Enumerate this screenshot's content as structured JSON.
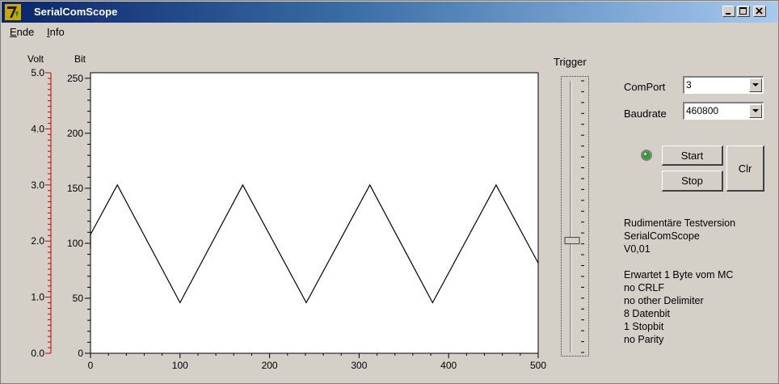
{
  "window": {
    "title": "SerialComScope",
    "app_icon": "delphi-icon"
  },
  "menu": {
    "items": [
      {
        "label": "Ende",
        "accel": "E",
        "rest": "nde"
      },
      {
        "label": "Info",
        "accel": "I",
        "rest": "nfo"
      }
    ]
  },
  "scope": {
    "volt_label": "Volt",
    "bit_label": "Bit",
    "volt_ticks": [
      "5.0",
      "4.0",
      "3.0",
      "2.0",
      "1.0",
      "0.0"
    ],
    "bit_ticks": [
      "250",
      "200",
      "150",
      "100",
      "50",
      "0"
    ],
    "x_ticks": [
      "0",
      "100",
      "200",
      "300",
      "400",
      "500"
    ],
    "trace_color": "#000000"
  },
  "chart_data": {
    "type": "line",
    "xlabel": "",
    "ylabel": "Bit",
    "xlim": [
      0,
      500
    ],
    "ylim": [
      0,
      255
    ],
    "x_ticks": [
      0,
      100,
      200,
      300,
      400,
      500
    ],
    "y_ticks": [
      0,
      50,
      100,
      150,
      200,
      250
    ],
    "secondary_axis": {
      "label": "Volt",
      "range": [
        0,
        5
      ],
      "ticks": [
        0,
        1,
        2,
        3,
        4,
        5
      ],
      "color": "#c00000"
    },
    "grid": false,
    "series": [
      {
        "x": [
          0,
          0,
          30,
          100,
          170,
          241,
          312,
          382,
          453,
          500
        ],
        "y": [
          95,
          108,
          153,
          46,
          153,
          46,
          153,
          46,
          153,
          82
        ]
      }
    ]
  },
  "trigger": {
    "label": "Trigger",
    "level_bit": 105
  },
  "controls": {
    "comport_label": "ComPort",
    "comport_value": "3",
    "baudrate_label": "Baudrate",
    "baudrate_value": "460800",
    "start_label": "Start",
    "stop_label": "Stop",
    "clear_label": "Clr",
    "led_color": "#2e9e2e"
  },
  "info": {
    "lines": [
      "Rudimentäre Testversion",
      "SerialComScope",
      "V0,01",
      "",
      "Erwartet 1 Byte vom MC",
      "no CRLF",
      "no other Delimiter",
      "8 Datenbit",
      "1 Stopbit",
      "no Parity"
    ]
  }
}
